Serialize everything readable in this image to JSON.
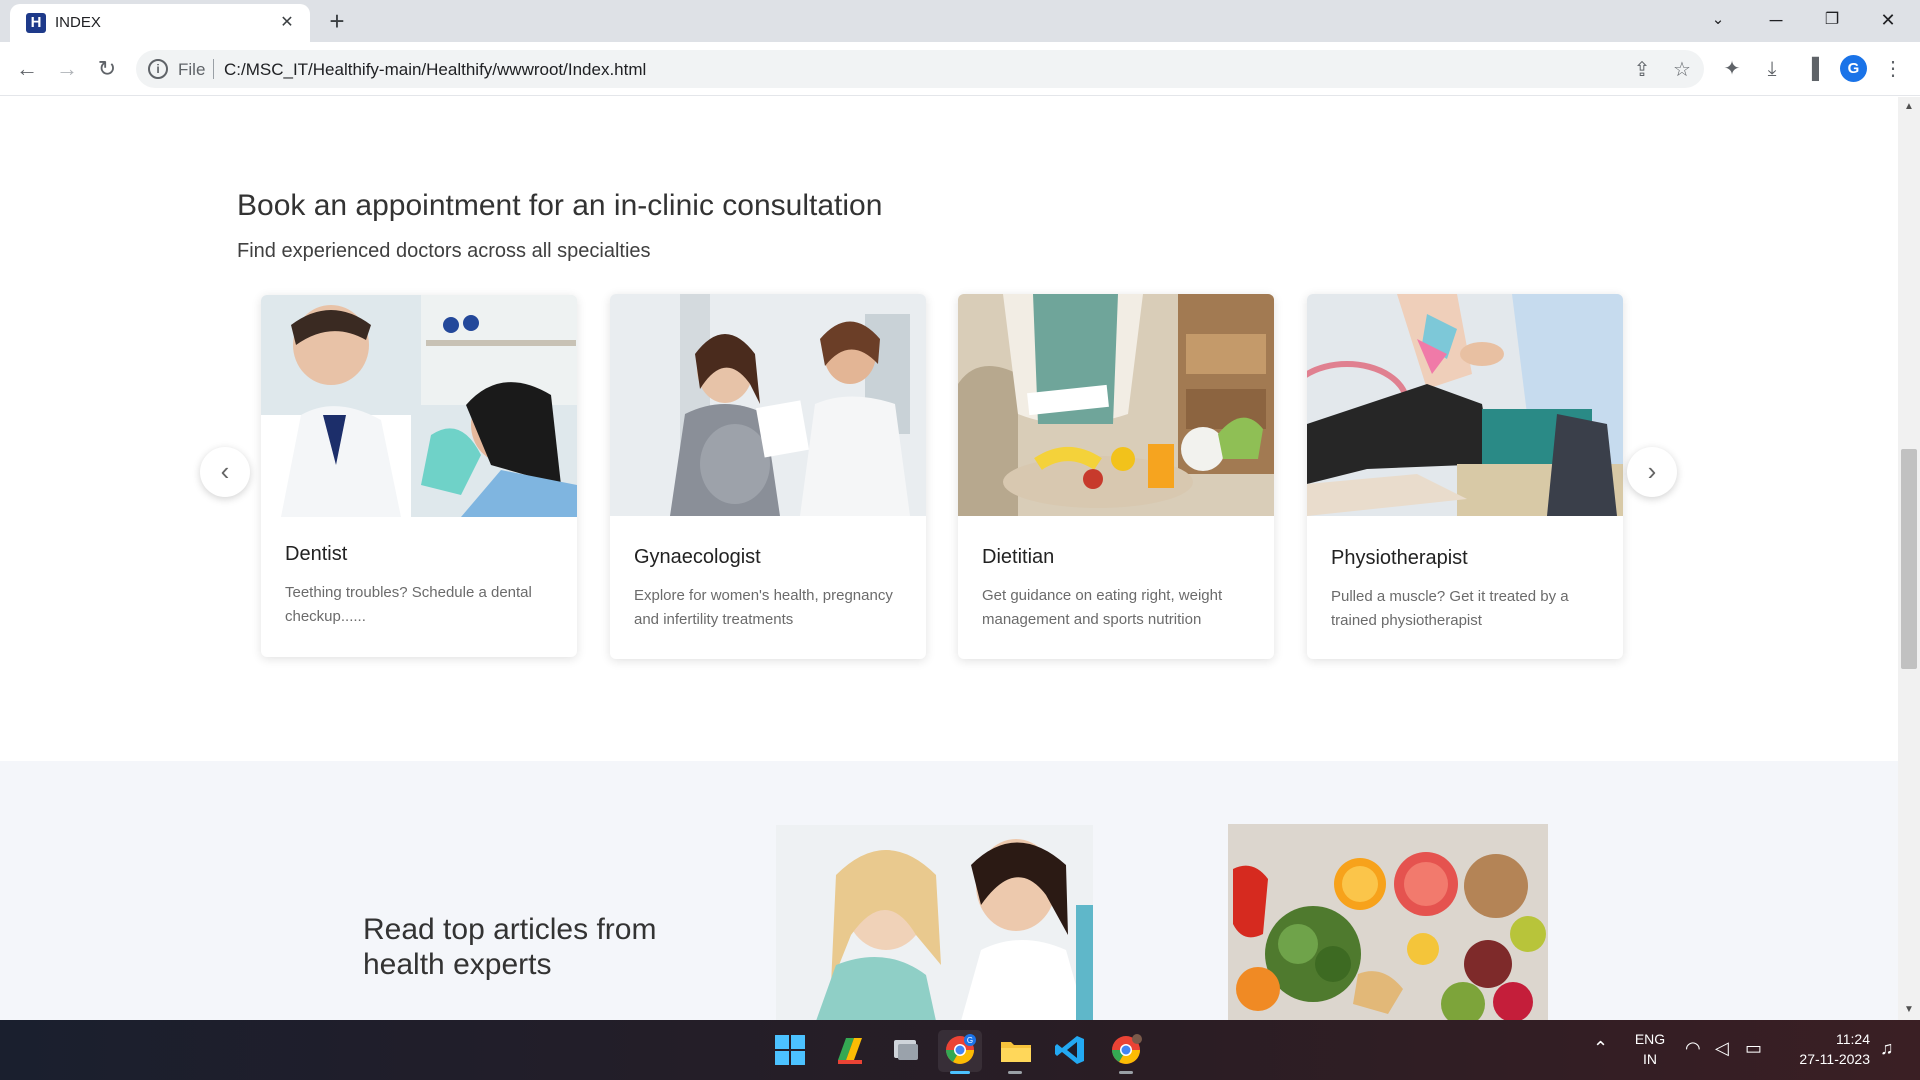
{
  "browser": {
    "tab_title": "INDEX",
    "tab_favicon_letter": "H",
    "new_tab_label": "+",
    "omnibox_scheme_label": "File",
    "url": "C:/MSC_IT/Healthify-main/Healthify/wwwroot/Index.html",
    "profile_initial": "G",
    "icons": [
      "back-icon",
      "forward-icon",
      "reload-icon",
      "info-icon",
      "share-icon",
      "star-icon",
      "extensions-icon",
      "download-icon",
      "side-panel-icon",
      "menu-icon"
    ]
  },
  "consultation": {
    "title": "Book an appointment for an in-clinic consultation",
    "subtitle": "Find experienced doctors across all specialties",
    "cards": [
      {
        "title": "Dentist",
        "description": "Teething troubles? Schedule a dental checkup......"
      },
      {
        "title": "Gynaecologist",
        "description": "Explore for women's health, pregnancy and infertility treatments"
      },
      {
        "title": "Dietitian",
        "description": "Get guidance on eating right, weight management and sports nutrition"
      },
      {
        "title": "Physiotherapist",
        "description": "Pulled a muscle? Get it treated by a trained physiotherapist"
      }
    ]
  },
  "articles": {
    "title": "Read top articles from health experts"
  },
  "taskbar": {
    "language_primary": "ENG",
    "language_secondary": "IN",
    "time": "11:24",
    "date": "27-11-2023",
    "chrome_badge": "G"
  }
}
